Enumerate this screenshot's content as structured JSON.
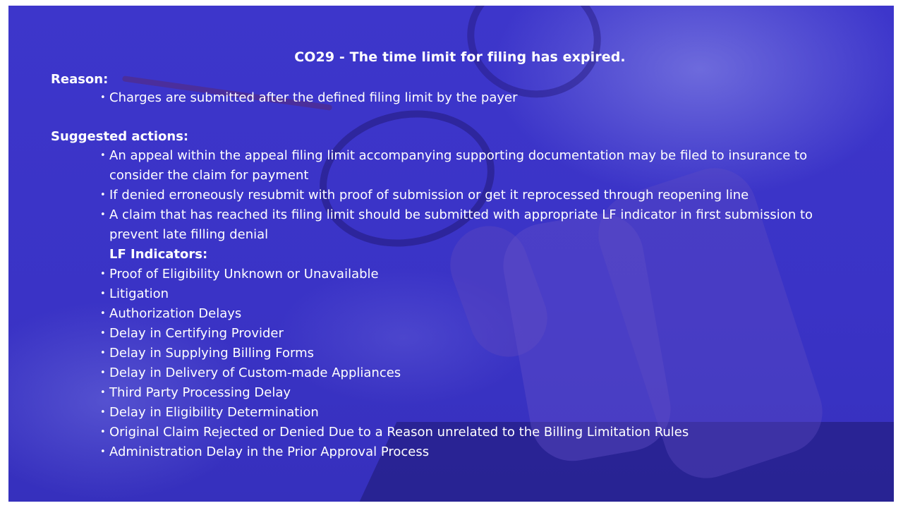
{
  "title": "CO29 - The time limit for filing has expired.",
  "reason": {
    "heading": "Reason:",
    "items": [
      "Charges are submitted after the defined filing limit by the payer"
    ]
  },
  "suggested_actions": {
    "heading": "Suggested actions:",
    "items": [
      "An appeal within the appeal filing limit accompanying supporting documentation may be filed to insurance to consider the claim for payment",
      "If denied erroneously resubmit with proof of submission or get it reprocessed through reopening line",
      "A claim that has reached its filing limit should be submitted with appropriate LF indicator in first submission to prevent late filling denial"
    ],
    "lf_heading": "LF Indicators:",
    "lf_items": [
      "Proof of Eligibility Unknown or Unavailable",
      "Litigation",
      "Authorization Delays",
      "Delay in Certifying Provider",
      "Delay in Supplying Billing Forms",
      "Delay in Delivery of Custom-made Appliances",
      "Third Party Processing Delay",
      "Delay in Eligibility Determination",
      "Original Claim Rejected or Denied Due to a Reason unrelated to the Billing Limitation Rules",
      "Administration Delay in the Prior Approval Process"
    ]
  },
  "bullet_glyph": "•",
  "colors": {
    "overlay": "#3b34c9",
    "text": "#ffffff"
  }
}
